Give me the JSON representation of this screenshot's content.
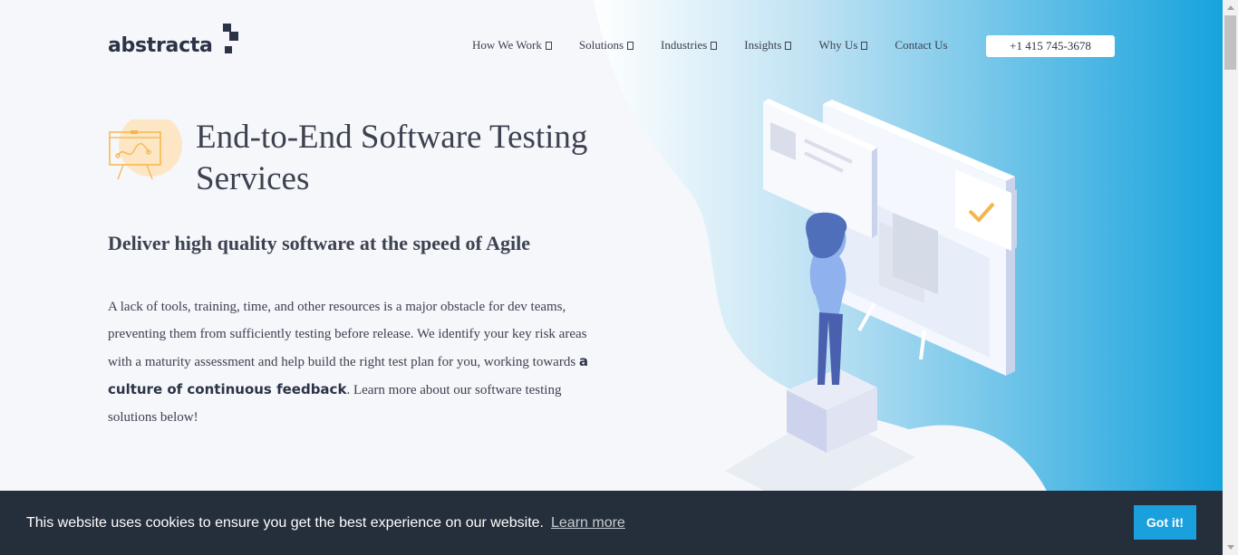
{
  "header": {
    "logo_text": "abstracta",
    "nav": [
      {
        "label": "How We Work",
        "icon": "chevron-down-icon"
      },
      {
        "label": "Solutions",
        "icon": "chevron-down-icon"
      },
      {
        "label": "Industries",
        "icon": "chevron-down-icon"
      },
      {
        "label": "Insights",
        "icon": "chevron-down-icon"
      },
      {
        "label": "Why Us",
        "icon": "chevron-down-icon"
      },
      {
        "label": "Contact Us"
      }
    ],
    "phone": "+1 415 745-3678"
  },
  "hero": {
    "icon": "presentation-board-icon",
    "title": "End-to-End Software Testing Services",
    "subtitle": "Deliver high quality software at the speed of Agile",
    "paragraph_before": "A lack of tools, training, time, and other resources is a major obstacle for dev teams, preventing them from sufficiently testing before release. We identify your key risk areas with a maturity assessment and help build the right test plan for you, working towards ",
    "paragraph_emphasis": "a culture of continuous feedback",
    "paragraph_after": ". Learn more about our software testing solutions below!",
    "illustration": "person-viewing-test-board-illustration"
  },
  "cookie": {
    "message": "This website uses cookies to ensure you get the best experience on our website.",
    "link": "Learn more",
    "button": "Got it!"
  },
  "colors": {
    "background": "#f5f7fb",
    "accent_blue": "#1aa0dd",
    "text_dark": "#2c3347",
    "cookie_bg": "#252e3b",
    "icon_orange": "#f5b54a"
  }
}
